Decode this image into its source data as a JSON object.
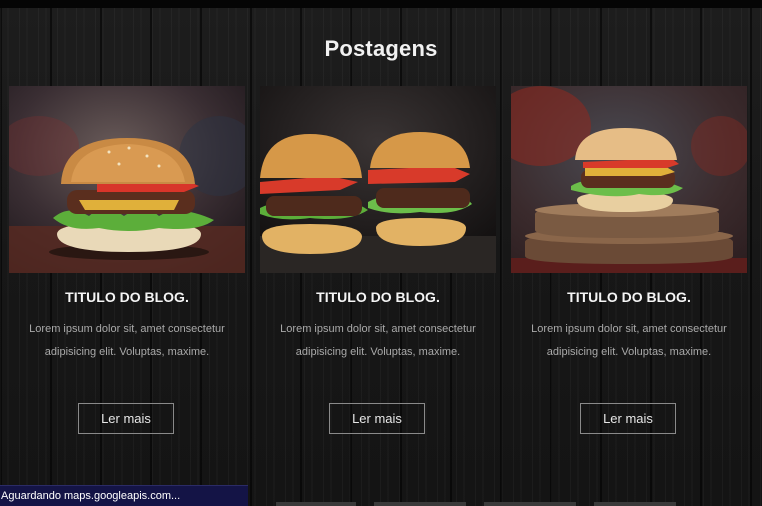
{
  "section": {
    "title": "Postagens"
  },
  "cards": [
    {
      "title": "TITULO DO BLOG.",
      "text": "Lorem ipsum dolor sit, amet consectetur adipisicing elit. Voluptas, maxime.",
      "button_label": "Ler mais",
      "image_name": "burger-photo-smoky-background"
    },
    {
      "title": "TITULO DO BLOG.",
      "text": "Lorem ipsum dolor sit, amet consectetur adipisicing elit. Voluptas, maxime.",
      "button_label": "Ler mais",
      "image_name": "two-burgers-photo"
    },
    {
      "title": "TITULO DO BLOG.",
      "text": "Lorem ipsum dolor sit, amet consectetur adipisicing elit. Voluptas, maxime.",
      "button_label": "Ler mais",
      "image_name": "burger-on-wood-board-photo"
    }
  ],
  "status_bar": {
    "text": "Aguardando maps.googleapis.com..."
  },
  "colors": {
    "background": "#171717",
    "button_border": "#8a8a8a",
    "body_text": "#a9a9a9",
    "status_bar": "#141446"
  }
}
